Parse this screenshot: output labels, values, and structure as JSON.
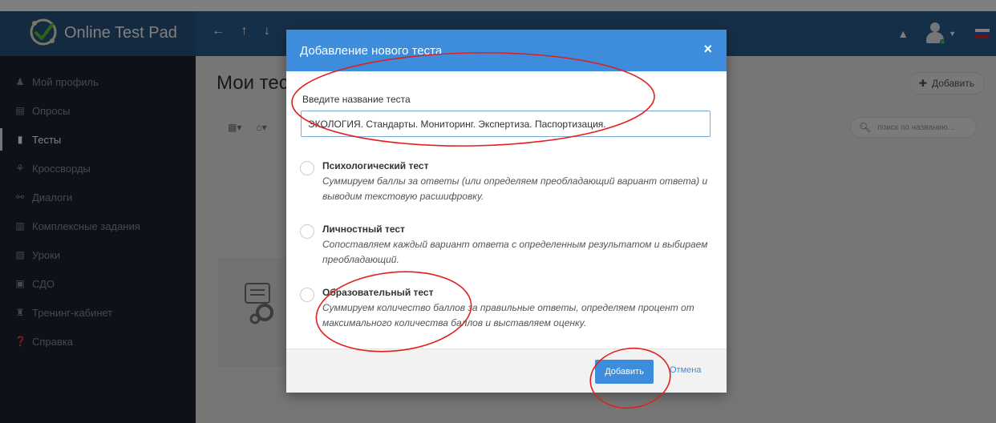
{
  "app": {
    "name": "Online Test Pad"
  },
  "topbar": {
    "nav_arrows": "←  ↑  ↓"
  },
  "sidebar": {
    "items": [
      {
        "label": "Мой профиль",
        "icon": "user-icon",
        "glyph": "♟",
        "active": false
      },
      {
        "label": "Опросы",
        "icon": "poll-icon",
        "glyph": "▤",
        "active": false
      },
      {
        "label": "Тесты",
        "icon": "test-icon",
        "glyph": "▮",
        "active": true
      },
      {
        "label": "Кроссворды",
        "icon": "crossword-icon",
        "glyph": "⚘",
        "active": false
      },
      {
        "label": "Диалоги",
        "icon": "dialog-icon",
        "glyph": "⚯",
        "active": false
      },
      {
        "label": "Комплексные задания",
        "icon": "tasks-icon",
        "glyph": "▥",
        "active": false
      },
      {
        "label": "Уроки",
        "icon": "lessons-icon",
        "glyph": "▧",
        "active": false
      },
      {
        "label": "СДО",
        "icon": "lms-icon",
        "glyph": "▣",
        "active": false
      },
      {
        "label": "Тренинг-кабинет",
        "icon": "training-icon",
        "glyph": "♜",
        "active": false
      },
      {
        "label": "Справка",
        "icon": "help-icon",
        "glyph": "❓",
        "active": false
      }
    ]
  },
  "main": {
    "title": "Мои тес",
    "add_button": "Добавить",
    "search_placeholder": "поиск по названию..."
  },
  "modal": {
    "title": "Добавление нового теста",
    "close": "×",
    "name_label": "Введите название теста",
    "name_value": "ЭКОЛОГИЯ. Стандарты. Мониторинг. Экспертиза. Паспортизация.",
    "options": [
      {
        "title": "Психологический тест",
        "description": "Суммируем баллы за ответы (или определяем преобладающий вариант ответа) и выводим текстовую расшифровку."
      },
      {
        "title": "Личностный тест",
        "description": "Сопоставляем каждый вариант ответа с определенным результатом и выбираем преобладающий."
      },
      {
        "title": "Образовательный тест",
        "description": "Суммируем количество баллов за правильные ответы, определяем процент от максимального количества баллов и выставляем оценку."
      }
    ],
    "submit": "Добавить",
    "cancel": "Отмена"
  },
  "colors": {
    "header_blue": "#3d8ddc",
    "topbar": "#2d5f92",
    "sidebar": "#1d2330",
    "annotation_red": "#e02020"
  }
}
